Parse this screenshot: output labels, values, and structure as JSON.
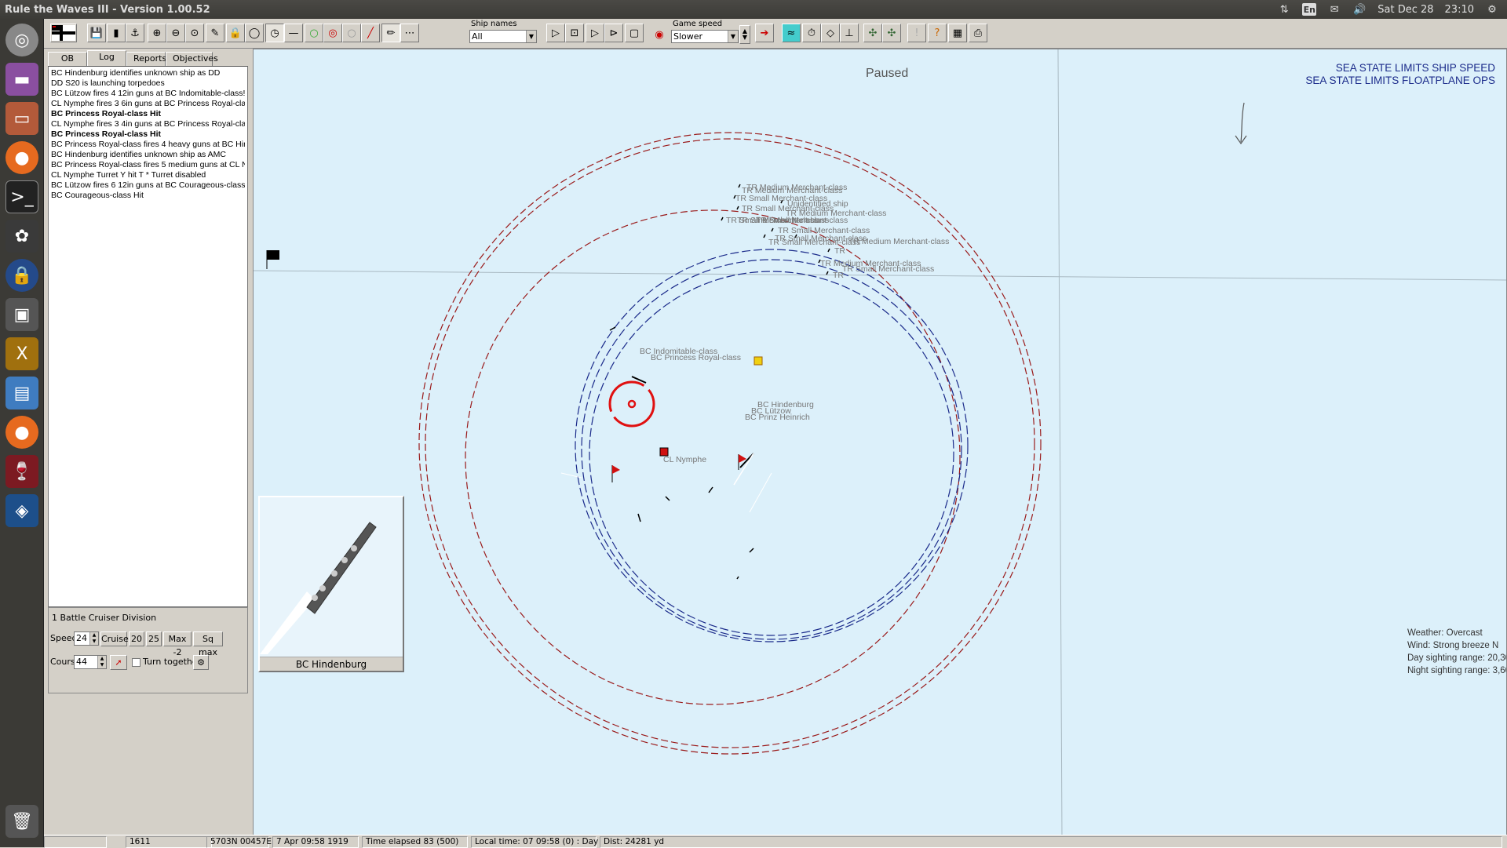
{
  "window": {
    "title": "Rule the Waves III - Version 1.00.52"
  },
  "systray": {
    "lang": "En",
    "date": "Sat Dec 28",
    "time": "23:10"
  },
  "toolbar": {
    "ship_names_label": "Ship names",
    "ship_names_value": "All",
    "game_speed_label": "Game speed",
    "game_speed_value": "Slower"
  },
  "tabs": [
    "OB",
    "Log",
    "Reports",
    "Objectives"
  ],
  "log": [
    {
      "text": "BC Hindenburg identifies unknown ship as DD",
      "bold": false
    },
    {
      "text": "DD S20 is launching torpedoes",
      "bold": false
    },
    {
      "text": "BC Lützow fires 4 12in guns at BC Indomitable-class!",
      "bold": false
    },
    {
      "text": "CL Nymphe fires 3 6in guns at BC Princess Royal-cla",
      "bold": false
    },
    {
      "text": "BC Princess Royal-class Hit",
      "bold": true
    },
    {
      "text": "CL Nymphe fires 3 4in guns at BC Princess Royal-cla",
      "bold": false
    },
    {
      "text": "BC Princess Royal-class Hit",
      "bold": true
    },
    {
      "text": "BC Princess Royal-class fires 4 heavy guns at BC Hir",
      "bold": false
    },
    {
      "text": "BC Hindenburg identifies unknown ship as AMC",
      "bold": false
    },
    {
      "text": "BC Princess Royal-class fires 5 medium guns at CL N",
      "bold": false
    },
    {
      "text": "CL Nymphe Turret Y hit T * Turret disabled",
      "bold": false
    },
    {
      "text": "BC Lützow fires 6 12in guns at BC Courageous-class!",
      "bold": false
    },
    {
      "text": "BC Courageous-class Hit",
      "bold": false
    }
  ],
  "division": {
    "name": "1 Battle Cruiser Division",
    "speed_label": "Speed",
    "speed_value": "24",
    "cruise_label": "Cruise",
    "b20": "20",
    "b25": "25",
    "max2": "Max -2",
    "sqmax": "Sq max",
    "course_label": "Course",
    "course_value": "44",
    "turn_together": "Turn together"
  },
  "ship_view": {
    "name": "BC Hindenburg"
  },
  "map": {
    "paused": "Paused",
    "notes": [
      "SEA STATE LIMITS SHIP SPEED",
      "SEA STATE LIMITS FLOATPLANE OPS"
    ],
    "labels": [
      {
        "text": "TR Medium Merchant-class"
      },
      {
        "text": "TR Medium Merchant-class"
      },
      {
        "text": "TR Small Merchant-class"
      },
      {
        "text": "Unidentified ship"
      },
      {
        "text": "TR Small Merchant-class"
      },
      {
        "text": "TR Medium Merchant-class"
      },
      {
        "text": "TR Small Merchant-class"
      },
      {
        "text": "TR Small Merchant-class"
      },
      {
        "text": "TR Small Merchant-class"
      },
      {
        "text": "TR Small Merchant-class"
      },
      {
        "text": "TR Small Merchant-class"
      },
      {
        "text": "TR Small Merchant-class"
      },
      {
        "text": "TR Medium Merchant-class"
      },
      {
        "text": "TR"
      },
      {
        "text": "TR Medium Merchant-class"
      },
      {
        "text": "TR Small Merchant-class"
      },
      {
        "text": "TR"
      },
      {
        "text": "BC Indomitable-class"
      },
      {
        "text": "BC Princess Royal-class"
      },
      {
        "text": "BC Hindenburg"
      },
      {
        "text": "BC Lützow"
      },
      {
        "text": "BC Prinz Heinrich"
      },
      {
        "text": "CL Nymphe"
      }
    ],
    "info": {
      "weather": "Weather: Overcast",
      "wind": "Wind: Strong breeze  N",
      "day_range": "Day sighting range: 20,300 yds",
      "night_range": "Night sighting range: 3,600 yds"
    }
  },
  "status": {
    "c1": "1611",
    "c2": "5703N 00457E",
    "c3": "7 Apr 09:58 1919",
    "c4": "Time elapsed 83 (500)",
    "c5": "Local time: 07 09:58 (0) : Day",
    "c6": "Dist: 24281 yd"
  }
}
